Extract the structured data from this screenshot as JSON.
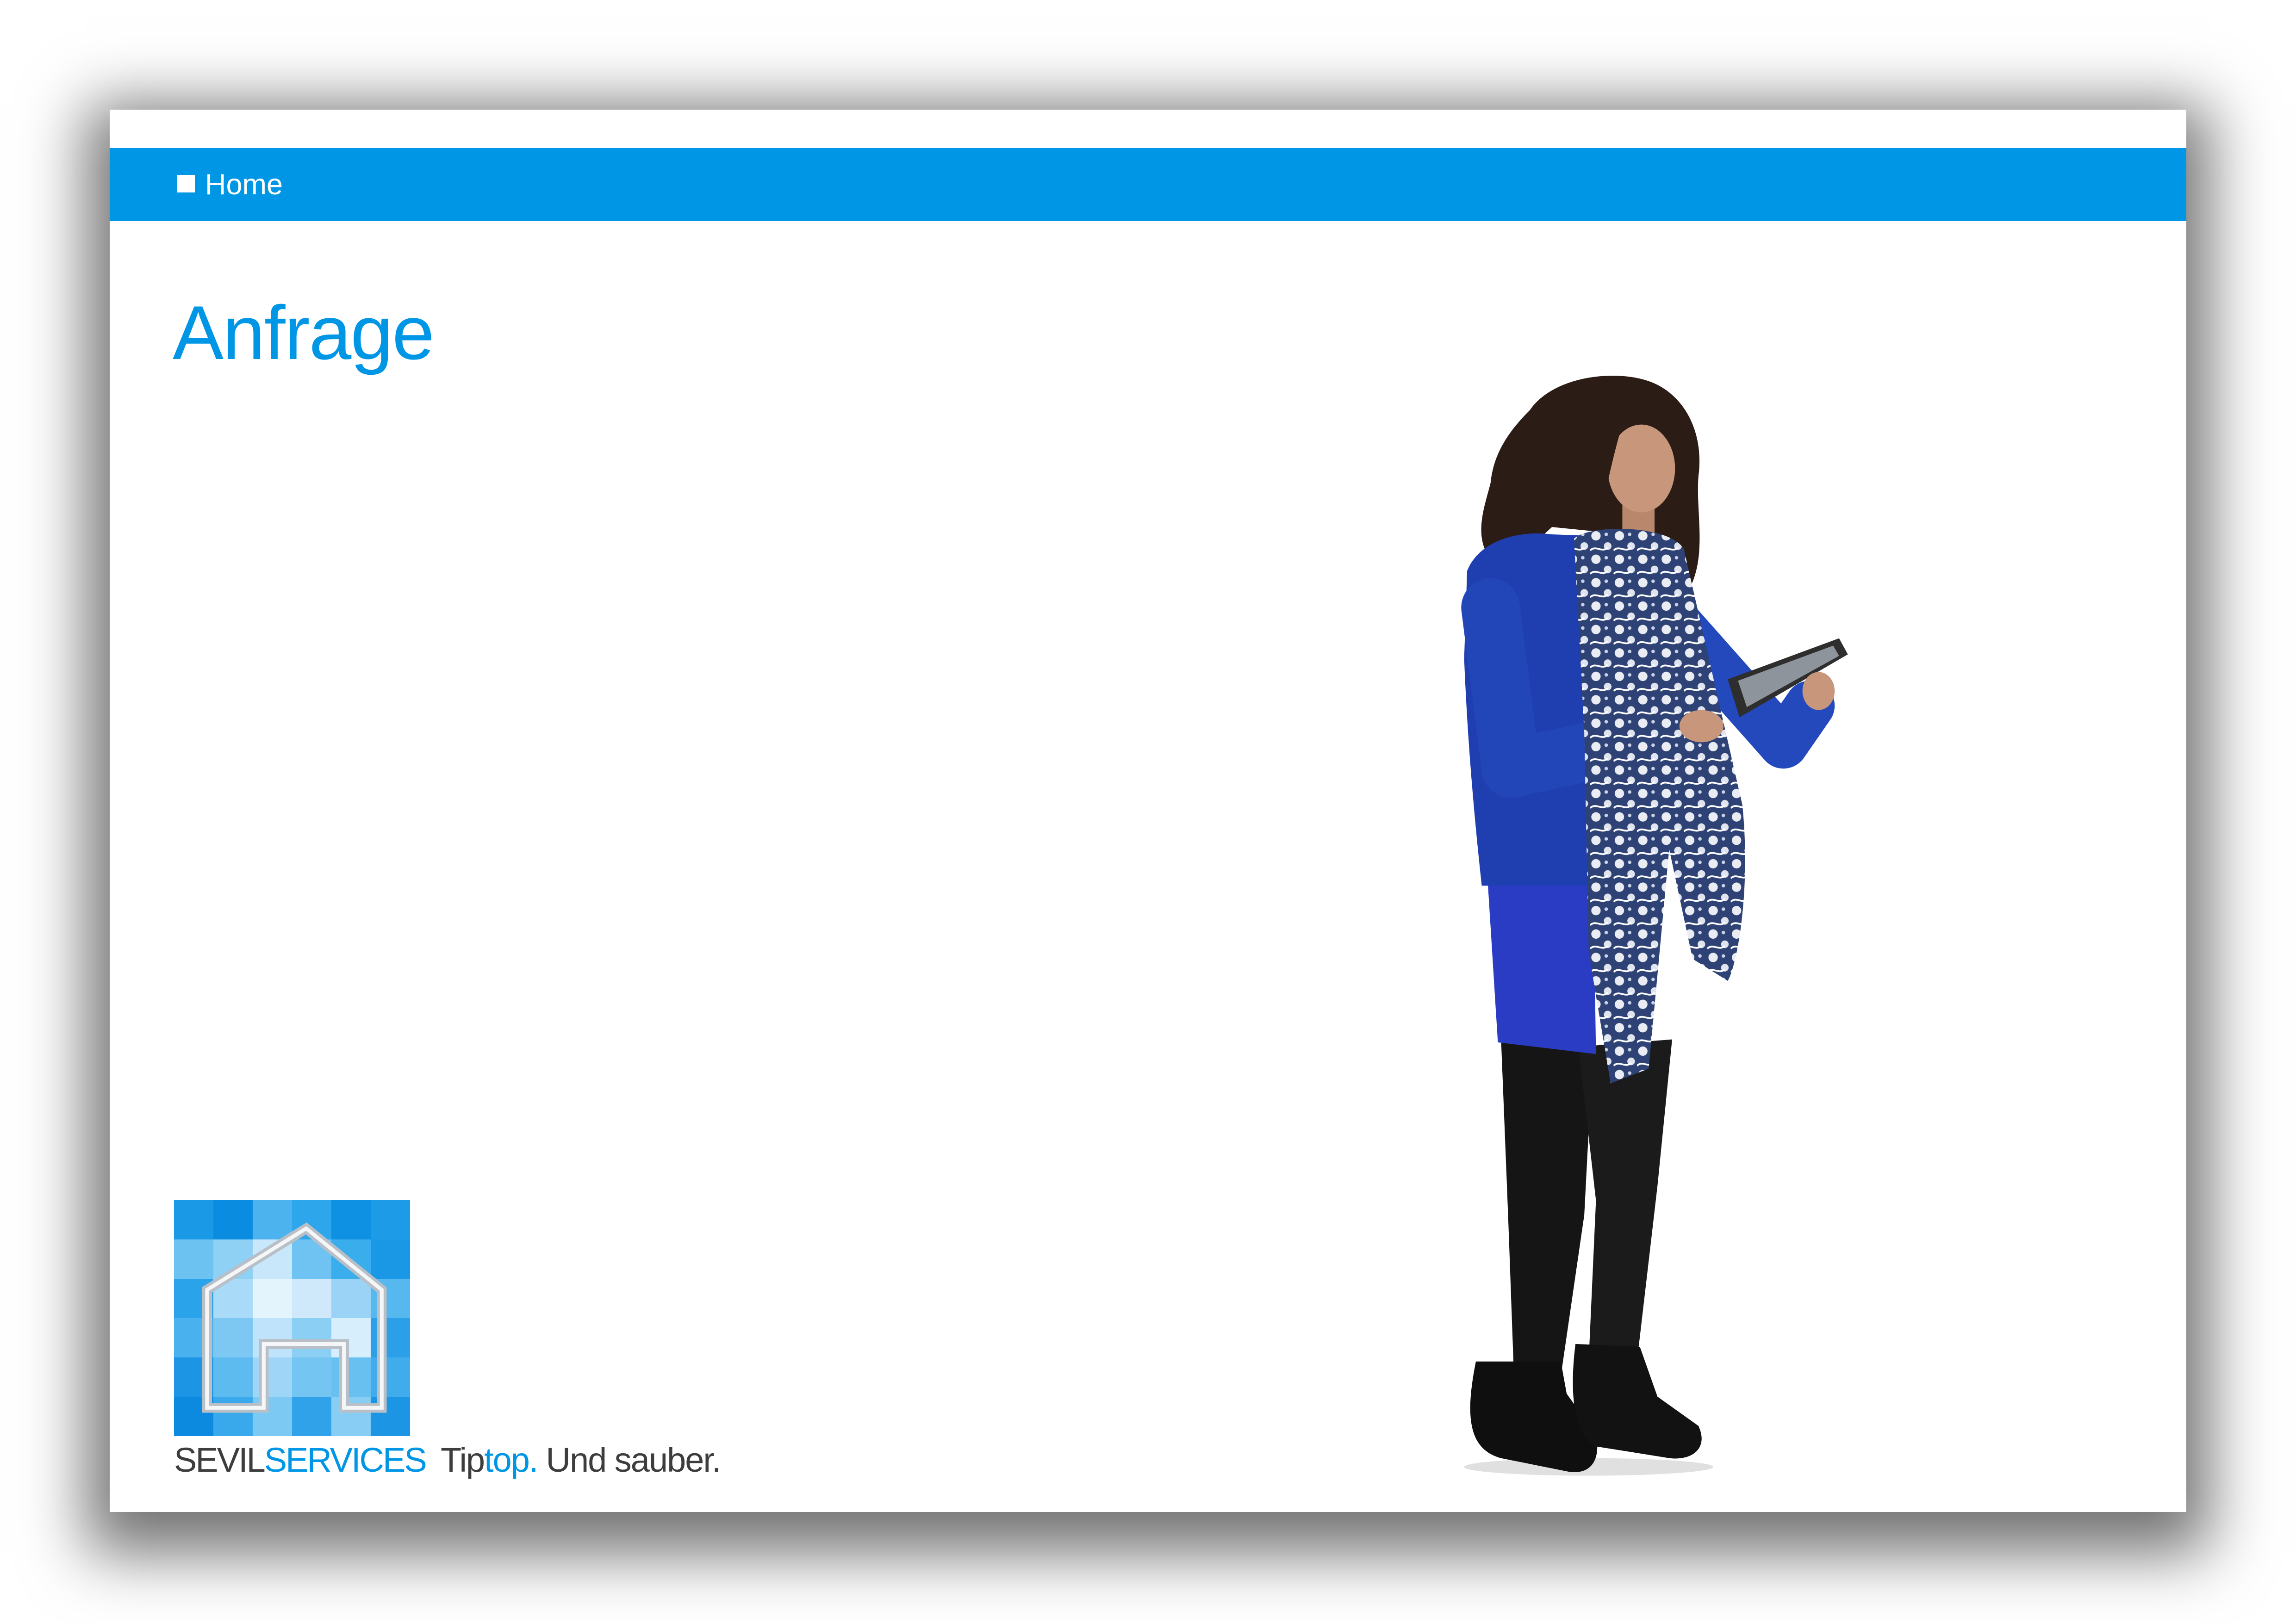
{
  "nav": {
    "home_label": "Home",
    "home_icon": "square-icon"
  },
  "page": {
    "title": "Anfrage"
  },
  "brand": {
    "name_part1": "SEVIL",
    "name_part2": "SERVICES",
    "slogan_part1": "Tip",
    "slogan_part2": "top.",
    "slogan_part3": "Und sauber.",
    "logo_icon": "house-icon",
    "logo_tile_colors": [
      [
        "#1a9ae6",
        "#0a8de0",
        "#4cb3ee",
        "#2ea6eb",
        "#0e91e2",
        "#1d9be6"
      ],
      [
        "#6cc2f1",
        "#8fd0f5",
        "#c8e7fb",
        "#6fc3f2",
        "#3aaeed",
        "#1a98e5"
      ],
      [
        "#2ba3ea",
        "#a9dbf8",
        "#e4f4fd",
        "#cfe9fb",
        "#9ad3f6",
        "#56b8ef"
      ],
      [
        "#48b1ee",
        "#7cc8f3",
        "#bfe3fa",
        "#8ccff5",
        "#d7eefc",
        "#2b9fe8"
      ],
      [
        "#1c96e4",
        "#5ebbf0",
        "#9fd6f7",
        "#74c5f2",
        "#68c0f1",
        "#40acec"
      ],
      [
        "#0b8ae0",
        "#3aa9eb",
        "#7ccaf4",
        "#2fa2ea",
        "#88cdf4",
        "#1b95e4"
      ]
    ]
  },
  "colors": {
    "accent": "#0096E6",
    "text": "#3d3d3d",
    "background": "#ffffff"
  }
}
